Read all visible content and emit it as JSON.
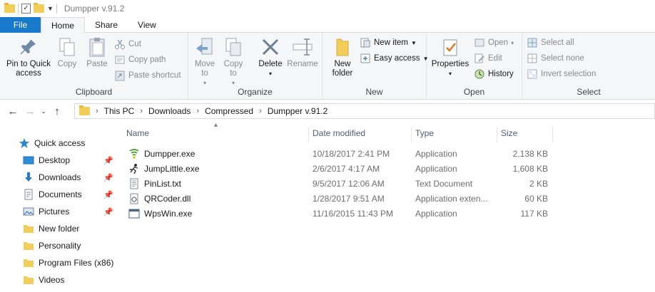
{
  "window": {
    "title": "Dumpper v.91.2"
  },
  "tabs": [
    {
      "label": "File"
    },
    {
      "label": "Home"
    },
    {
      "label": "Share"
    },
    {
      "label": "View"
    }
  ],
  "ribbon": {
    "clipboard": {
      "label": "Clipboard",
      "pin_to_quick_access": "Pin to Quick access",
      "copy": "Copy",
      "paste": "Paste",
      "cut": "Cut",
      "copy_path": "Copy path",
      "paste_shortcut": "Paste shortcut"
    },
    "organize": {
      "label": "Organize",
      "move_to": "Move to",
      "copy_to": "Copy to",
      "delete": "Delete",
      "rename": "Rename"
    },
    "new": {
      "label": "New",
      "new_folder": "New folder",
      "new_item": "New item",
      "easy_access": "Easy access"
    },
    "open": {
      "label": "Open",
      "properties": "Properties",
      "open": "Open",
      "edit": "Edit",
      "history": "History"
    },
    "select": {
      "label": "Select",
      "select_all": "Select all",
      "select_none": "Select none",
      "invert_selection": "Invert selection"
    }
  },
  "breadcrumb": [
    "This PC",
    "Downloads",
    "Compressed",
    "Dumpper v.91.2"
  ],
  "nav_pane": {
    "quick_access": "Quick access",
    "items": [
      {
        "label": "Desktop",
        "icon": "desktop-icon",
        "pinned": true
      },
      {
        "label": "Downloads",
        "icon": "download-icon",
        "pinned": true
      },
      {
        "label": "Documents",
        "icon": "documents-icon",
        "pinned": true
      },
      {
        "label": "Pictures",
        "icon": "pictures-icon",
        "pinned": true
      },
      {
        "label": "New folder",
        "icon": "folder-icon",
        "pinned": false
      },
      {
        "label": "Personality",
        "icon": "folder-icon",
        "pinned": false
      },
      {
        "label": "Program Files (x86)",
        "icon": "folder-icon",
        "pinned": false
      },
      {
        "label": "Videos",
        "icon": "folder-icon",
        "pinned": false
      }
    ]
  },
  "file_list": {
    "columns": [
      "Name",
      "Date modified",
      "Type",
      "Size"
    ],
    "rows": [
      {
        "name": "Dumpper.exe",
        "date": "10/18/2017 2:41 PM",
        "type": "Application",
        "size": "2,138 KB",
        "icon": "dumpper-app-icon"
      },
      {
        "name": "JumpLittle.exe",
        "date": "2/6/2017 4:17 AM",
        "type": "Application",
        "size": "1,608 KB",
        "icon": "jumplittle-app-icon"
      },
      {
        "name": "PinList.txt",
        "date": "9/5/2017 12:06 AM",
        "type": "Text Document",
        "size": "2 KB",
        "icon": "text-file-icon"
      },
      {
        "name": "QRCoder.dll",
        "date": "1/28/2017 9:51 AM",
        "type": "Application exten...",
        "size": "60 KB",
        "icon": "dll-file-icon"
      },
      {
        "name": "WpsWin.exe",
        "date": "11/16/2015 11:43 PM",
        "type": "Application",
        "size": "117 KB",
        "icon": "app-window-icon"
      }
    ]
  },
  "colors": {
    "file_tab": "#1979ca",
    "ribbon_bg": "#f5f6f7",
    "folder": "#f3cd5a",
    "column_header_text": "#4c607a"
  }
}
